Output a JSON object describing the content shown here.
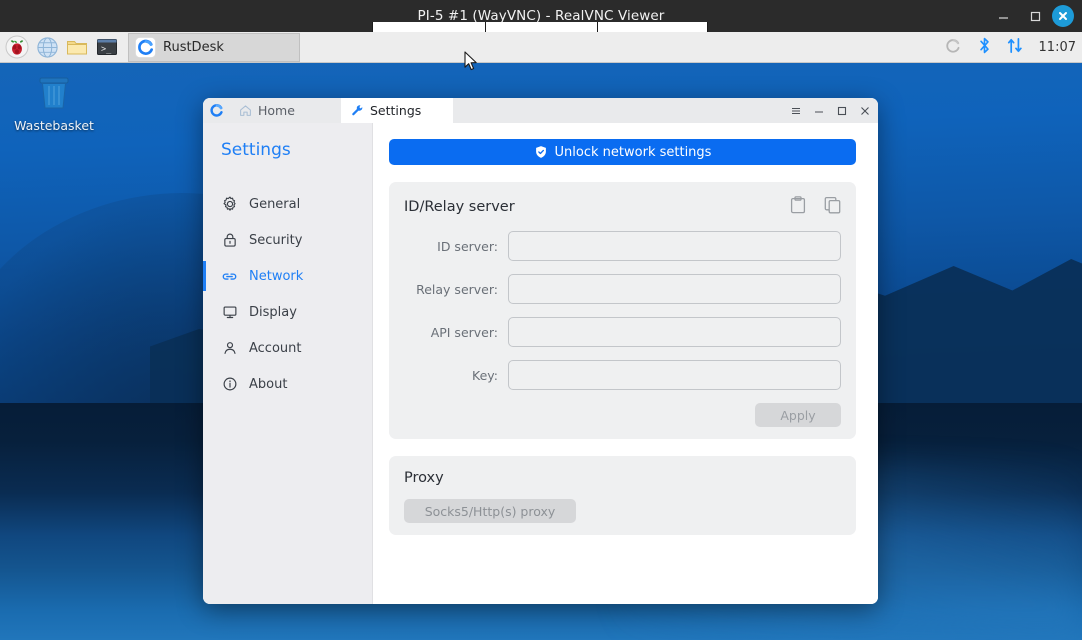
{
  "vnc_window": {
    "title": "PI-5 #1 (WayVNC) - RealVNC Viewer",
    "controls": {
      "minimize": "—",
      "maximize": "□",
      "close": "✕"
    }
  },
  "taskbar": {
    "launchers": [
      {
        "name": "raspberry-pi-menu-icon",
        "label": "Raspberry Pi Menu"
      },
      {
        "name": "web-browser-icon",
        "label": "Web Browser"
      },
      {
        "name": "file-manager-icon",
        "label": "File Manager"
      },
      {
        "name": "terminal-icon",
        "label": "Terminal"
      }
    ],
    "task": {
      "label": "RustDesk",
      "icon": "rustdesk-icon"
    },
    "tray": [
      {
        "name": "rustdesk-tray-icon",
        "label": "RustDesk"
      },
      {
        "name": "bluetooth-icon",
        "label": "Bluetooth"
      },
      {
        "name": "network-icon",
        "label": "Network"
      }
    ],
    "clock": "11:07"
  },
  "desktop": {
    "icons": [
      {
        "name": "wastebasket-icon",
        "label": "Wastebasket"
      }
    ]
  },
  "rustdesk": {
    "tabs": [
      {
        "label": "Home",
        "icon": "home-icon",
        "active": false
      },
      {
        "label": "Settings",
        "icon": "wrench-icon",
        "active": true
      }
    ],
    "window_controls": {
      "menu": "≡",
      "minimize": "—",
      "maximize": "□",
      "close": "✕"
    },
    "sidebar": {
      "title": "Settings",
      "items": [
        {
          "label": "General",
          "icon": "gear-icon",
          "active": false
        },
        {
          "label": "Security",
          "icon": "lock-icon",
          "active": false
        },
        {
          "label": "Network",
          "icon": "link-icon",
          "active": true
        },
        {
          "label": "Display",
          "icon": "monitor-icon",
          "active": false
        },
        {
          "label": "Account",
          "icon": "person-icon",
          "active": false
        },
        {
          "label": "About",
          "icon": "info-icon",
          "active": false
        }
      ]
    },
    "content": {
      "unlock_button": {
        "label": "Unlock network settings",
        "icon": "shield-icon"
      },
      "id_relay_card": {
        "title": "ID/Relay server",
        "actions": [
          {
            "name": "paste-icon",
            "label": "Paste"
          },
          {
            "name": "copy-icon",
            "label": "Copy"
          }
        ],
        "fields": [
          {
            "label": "ID server:",
            "value": "",
            "placeholder": ""
          },
          {
            "label": "Relay server:",
            "value": "",
            "placeholder": ""
          },
          {
            "label": "API server:",
            "value": "",
            "placeholder": ""
          },
          {
            "label": "Key:",
            "value": "",
            "placeholder": ""
          }
        ],
        "apply_button": {
          "label": "Apply",
          "enabled": false
        }
      },
      "proxy_card": {
        "title": "Proxy",
        "proxy_button": {
          "label": "Socks5/Http(s) proxy",
          "enabled": false
        }
      }
    }
  },
  "colors": {
    "accent_blue": "#0a6cf1",
    "sidebar_active": "#1f7ff5",
    "vnc_titlebar": "#2b2b2b",
    "vnc_close": "#1d9bd8",
    "taskbar": "#ededed",
    "card_bg": "#eff0f1",
    "disabled_btn": "#d6d7d9"
  }
}
